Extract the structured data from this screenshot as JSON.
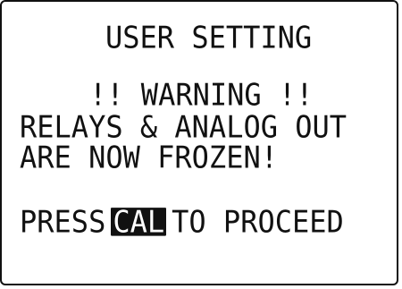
{
  "screen": {
    "title": "USER SETTING",
    "warning": "!! WARNING !!",
    "message_line_1": "RELAYS & ANALOG OUT",
    "message_line_2": "ARE NOW FROZEN!",
    "prompt": {
      "prefix": "PRESS",
      "key_label": "CAL",
      "suffix": "TO PROCEED"
    }
  },
  "colors": {
    "background": "#ffffff",
    "text": "#111111",
    "key_highlight_bg": "#111111",
    "key_highlight_fg": "#ffffff"
  }
}
